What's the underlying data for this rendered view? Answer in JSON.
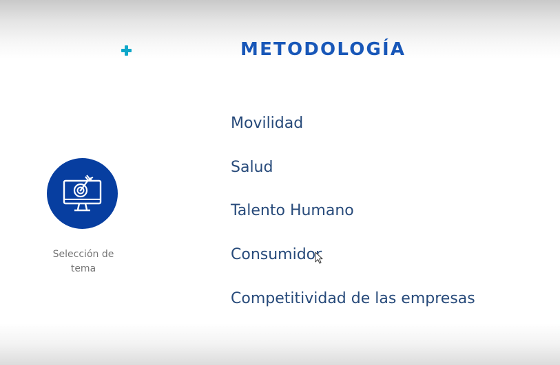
{
  "header": {
    "title": "METODOLOGÍA",
    "accent_icon": "plus-icon",
    "title_color": "#1857b8",
    "accent_color": "#10a7c9"
  },
  "topic_card": {
    "icon": "monitor-target-icon",
    "circle_color": "#073ea0",
    "caption_line1": "Selección de",
    "caption_line2": "tema"
  },
  "topics": [
    {
      "label": "Movilidad"
    },
    {
      "label": "Salud"
    },
    {
      "label": "Talento Humano"
    },
    {
      "label": "Consumidor"
    },
    {
      "label": "Competitividad de las empresas"
    }
  ],
  "pointer": {
    "icon": "mouse-cursor-icon"
  }
}
